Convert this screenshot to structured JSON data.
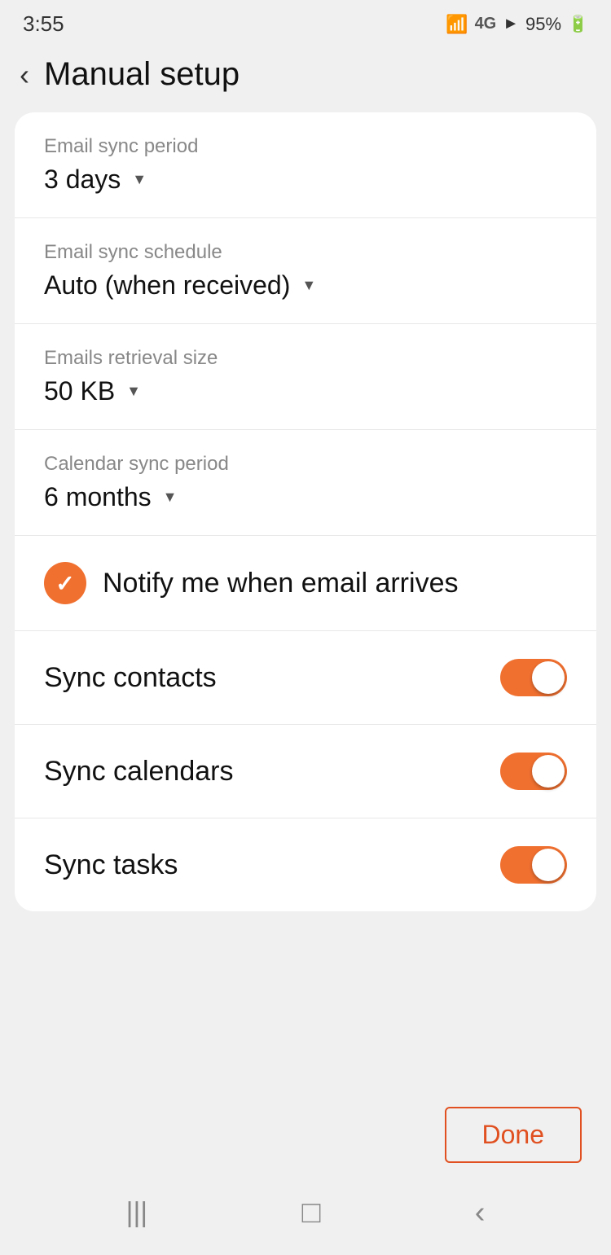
{
  "statusBar": {
    "time": "3:55",
    "battery": "95%"
  },
  "header": {
    "backLabel": "‹",
    "title": "Manual setup"
  },
  "settings": {
    "emailSyncPeriod": {
      "label": "Email sync period",
      "value": "3 days"
    },
    "emailSyncSchedule": {
      "label": "Email sync schedule",
      "value": "Auto (when received)"
    },
    "emailsRetrievalSize": {
      "label": "Emails retrieval size",
      "value": "50 KB"
    },
    "calendarSyncPeriod": {
      "label": "Calendar sync period",
      "value": "6 months"
    },
    "notifyEmail": {
      "label": "Notify me when email arrives",
      "checked": true
    },
    "syncContacts": {
      "label": "Sync contacts",
      "enabled": true
    },
    "syncCalendars": {
      "label": "Sync calendars",
      "enabled": true
    },
    "syncTasks": {
      "label": "Sync tasks",
      "enabled": true
    }
  },
  "footer": {
    "doneLabel": "Done"
  },
  "navBar": {
    "menuIcon": "|||",
    "homeIcon": "□",
    "backIcon": "‹"
  }
}
